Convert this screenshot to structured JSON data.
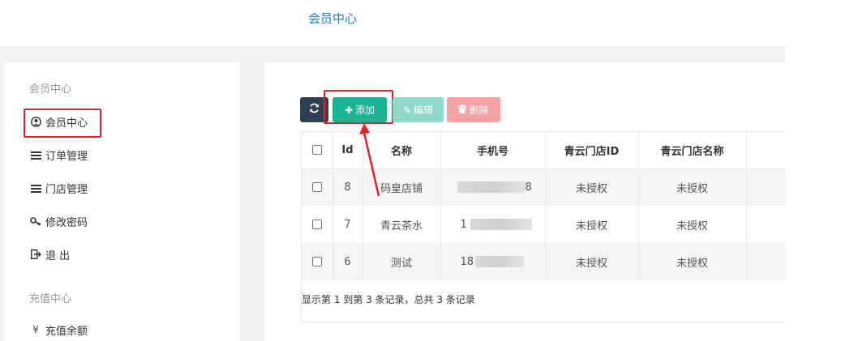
{
  "header": {
    "title": "会员中心"
  },
  "sidebar": {
    "sections": [
      {
        "title": "会员中心",
        "items": [
          {
            "label": "会员中心",
            "icon": "user-circle-icon"
          },
          {
            "label": "订单管理",
            "icon": "list-icon"
          },
          {
            "label": "门店管理",
            "icon": "list-icon",
            "highlighted": true
          },
          {
            "label": "修改密码",
            "icon": "key-icon"
          },
          {
            "label": "退 出",
            "icon": "sign-out-icon"
          }
        ]
      },
      {
        "title": "充值中心",
        "items": [
          {
            "label": "充值余额",
            "icon": "yen-icon"
          }
        ]
      }
    ]
  },
  "toolbar": {
    "refresh_icon": "refresh-icon",
    "add_label": "添加",
    "edit_label": "编辑",
    "delete_label": "删除"
  },
  "table": {
    "columns": [
      "Id",
      "名称",
      "手机号",
      "青云门店ID",
      "青云门店名称"
    ],
    "rows": [
      {
        "id": "8",
        "name": "码皇店铺",
        "phone_visible": "8",
        "store_id": "未授权",
        "store_name": "未授权"
      },
      {
        "id": "7",
        "name": "青云茶水",
        "phone_visible": "1",
        "store_id": "未授权",
        "store_name": "未授权"
      },
      {
        "id": "6",
        "name": "测试",
        "phone_visible": "18",
        "store_id": "未授权",
        "store_name": "未授权"
      }
    ]
  },
  "pagination": {
    "summary": "显示第 1 到第 3 条记录，总共 3 条记录"
  },
  "colors": {
    "accent": "#1c84c6",
    "add": "#1ab394",
    "highlight": "#e0242a",
    "dark": "#2f4050"
  }
}
